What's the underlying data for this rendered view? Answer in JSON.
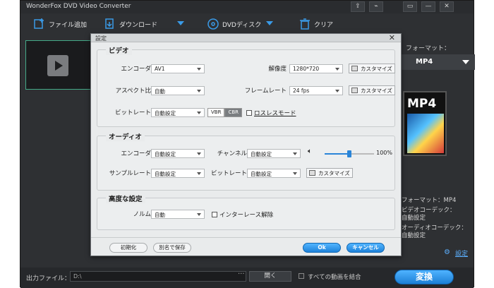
{
  "app": {
    "title": "WonderFox DVD Video Converter",
    "window_buttons": [
      "⇪",
      "⌁",
      "▭",
      "—",
      "✕"
    ]
  },
  "toolbar": {
    "add_file": "ファイル追加",
    "download": "ダウンロード",
    "dvd_disc": "DVDディスク",
    "clear": "クリア"
  },
  "right_panel": {
    "format_label": "フォーマット：",
    "format_value": "MP4",
    "mp4_icon_text": "MP4",
    "info_format": "フォーマット：MP4",
    "info_video_codec": "ビデオコーデック：",
    "info_video_codec_val": "自動設定",
    "info_audio_codec": "オーディオコーデック：",
    "info_audio_codec_val": "自動設定",
    "settings_link": "設定"
  },
  "bottom": {
    "output_label": "出力ファイル：",
    "output_path": "D:\\",
    "dots": "···",
    "open_button": "開く",
    "merge_label": "すべての動画を結合",
    "convert_button": "変換"
  },
  "dialog": {
    "title": "設定",
    "close": "✕",
    "video": {
      "group_title": "ビデオ",
      "encoder_label": "エンコーダ",
      "encoder_value": "AV1",
      "resolution_label": "解像度",
      "resolution_value": "1280*720",
      "aspect_label": "アスペクト比",
      "aspect_value": "自動",
      "framerate_label": "フレームレート",
      "framerate_value": "24 fps",
      "bitrate_label": "ビットレート",
      "bitrate_value": "自動設定",
      "vbr": "VBR",
      "cbr": "CBR",
      "lossless_label": "ロスレスモード",
      "customize": "カスタマイズ"
    },
    "audio": {
      "group_title": "オーディオ",
      "encoder_label": "エンコーダ",
      "encoder_value": "自動設定",
      "channel_label": "チャンネル",
      "channel_value": "自動設定",
      "volume_percent": "100%",
      "volume_level": 0.5,
      "samplerate_label": "サンプルレート",
      "samplerate_value": "自動設定",
      "bitrate_label": "ビットレート",
      "bitrate_value": "自動設定",
      "customize": "カスタマイズ"
    },
    "advanced": {
      "group_title": "高度な設定",
      "norm_label": "ノルム",
      "norm_value": "自動",
      "deinterlace_label": "インターレース解除"
    },
    "buttons": {
      "reset": "初期化",
      "save_as": "別名で保存",
      "ok": "Ok",
      "cancel": "キャンセル"
    }
  },
  "colors": {
    "accent": "#2a85d8",
    "window_bg": "#2e3033",
    "dialog_bg": "#e9ebec"
  }
}
